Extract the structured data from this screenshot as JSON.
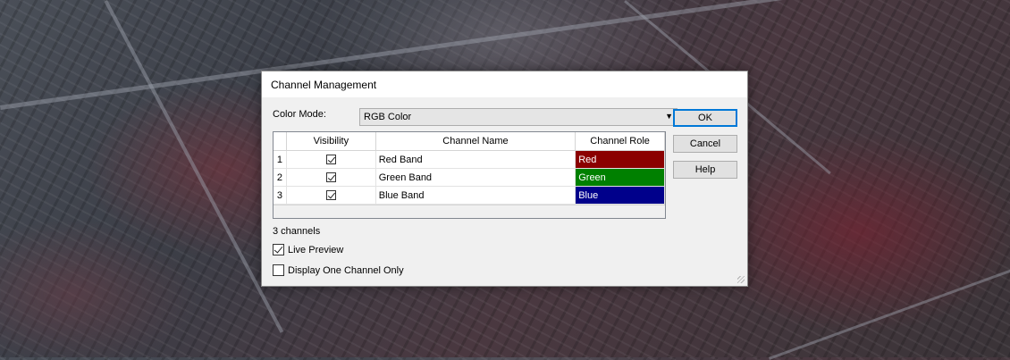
{
  "dialog": {
    "title": "Channel Management",
    "color_mode_label": "Color Mode:",
    "color_mode_value": "RGB Color",
    "table": {
      "headers": {
        "num": "",
        "visibility": "Visibility",
        "name": "Channel Name",
        "role": "Channel Role"
      },
      "rows": [
        {
          "num": "1",
          "visible": true,
          "name": "Red Band",
          "role": "Red",
          "role_color": "#8b0000"
        },
        {
          "num": "2",
          "visible": true,
          "name": "Green Band",
          "role": "Green",
          "role_color": "#008000"
        },
        {
          "num": "3",
          "visible": true,
          "name": "Blue Band",
          "role": "Blue",
          "role_color": "#00008b"
        }
      ]
    },
    "channel_count_text": "3 channels",
    "live_preview": {
      "label": "Live Preview",
      "checked": true
    },
    "one_channel": {
      "label": "Display One Channel Only",
      "checked": false
    },
    "buttons": {
      "ok": "OK",
      "cancel": "Cancel",
      "help": "Help"
    }
  },
  "colors": {
    "accent": "#0078d7"
  }
}
